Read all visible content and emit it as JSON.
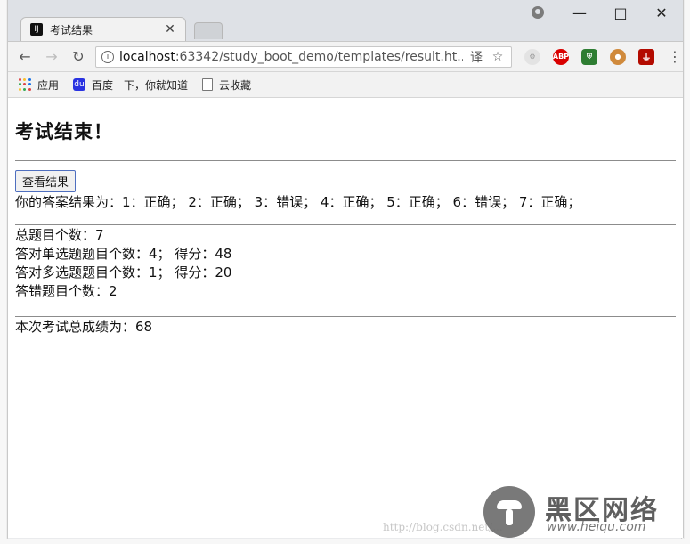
{
  "browser": {
    "tab_title": "考试结果",
    "tab_favicon": "IJ",
    "url_host": "localhost",
    "url_rest": ":63342/study_boot_demo/templates/result.ht...",
    "window_controls": {
      "minimize": "—",
      "maximize": "□",
      "close": "✕"
    },
    "nav": {
      "back": "←",
      "forward": "→",
      "reload": "↻"
    },
    "extensions": [
      "abp-icon",
      "ublock-icon",
      "cookie-icon",
      "pdf-icon"
    ],
    "bookmarks": [
      {
        "label": "应用",
        "icon": "apps-icon"
      },
      {
        "label": "百度一下，你就知道",
        "icon": "baidu-icon"
      },
      {
        "label": "云收藏",
        "icon": "folder-icon"
      }
    ]
  },
  "page": {
    "title": "考试结束！",
    "view_button": "查看结果",
    "answer_result": "你的答案结果为：1：正确； 2：正确； 3：错误； 4：正确； 5：正确； 6：错误； 7：正确；",
    "total_questions": "总题目个数：7",
    "single_correct": "答对单选题题目个数：4； 得分：48",
    "multi_correct": "答对多选题题目个数：1； 得分：20",
    "wrong_count": "答错题目个数：2",
    "final_score": "本次考试总成绩为：68"
  },
  "watermark": {
    "url": "http://blog.csdn.net/...",
    "logo_text": "黑区网络",
    "logo_sub": "www.heiqu.com"
  },
  "colors": {
    "titlebar": "#dee1e6",
    "toolbar": "#f2f2f2",
    "button_border": "#4f6fbf"
  }
}
